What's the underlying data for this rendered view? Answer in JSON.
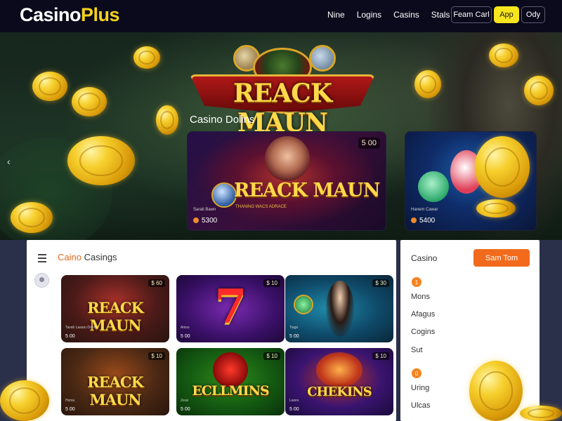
{
  "header": {
    "logo_part1": "Casino",
    "logo_part2": "Plus",
    "nav": [
      "Nine",
      "Logins",
      "Casins",
      "Stals"
    ],
    "btn_outline": "Feam Carl",
    "btn_primary": "App",
    "btn_secondary": "Ody"
  },
  "hero": {
    "title": "REACK MAUN",
    "subtitle": "Casino Dolins",
    "prev_arrow": "‹",
    "next_arrow": "›",
    "featured_card": {
      "title": "REACK MAUN",
      "badge": "5 00",
      "small_text": "THANING WACS ADRACE",
      "tiny_text": "Sarati Bawn",
      "footer": "5300"
    },
    "side_card": {
      "tiny_text": "Hanem Cawar",
      "footer": "5400"
    }
  },
  "panel": {
    "title_accent": "Caino",
    "title_rest": " Casings",
    "tiles": [
      {
        "name": "REACK MAUN",
        "badge": "$ 60",
        "small": "Tavah Lasaru Dorin",
        "foot": "5 00"
      },
      {
        "name": "7",
        "badge": "$ 10",
        "small": "Aniso",
        "foot": "5 00"
      },
      {
        "name": "",
        "badge": "$ 30",
        "small": "Tiago",
        "foot": "5 00"
      },
      {
        "name": "REACK MAUN",
        "badge": "$ 10",
        "small": "Horsu",
        "foot": "5 00"
      },
      {
        "name": "ECLLMINS",
        "badge": "$ 10",
        "small": "Zeus",
        "foot": "5 00"
      },
      {
        "name": "CHEKINS",
        "badge": "$ 10",
        "small": "Laxes",
        "foot": "5 00"
      }
    ]
  },
  "sidebar": {
    "title": "Casino",
    "button": "Sam Tom",
    "dot1": "1",
    "dot2": "0",
    "items1": [
      "Mons",
      "Afagus",
      "Cogins",
      "Sut"
    ],
    "items2": [
      "Uring",
      "Ulcas"
    ]
  },
  "colors": {
    "accent_yellow": "#f4d21c",
    "primary_orange": "#f26b1d",
    "header_bg": "#0b0a1c",
    "main_bg": "#2a2f4a"
  }
}
